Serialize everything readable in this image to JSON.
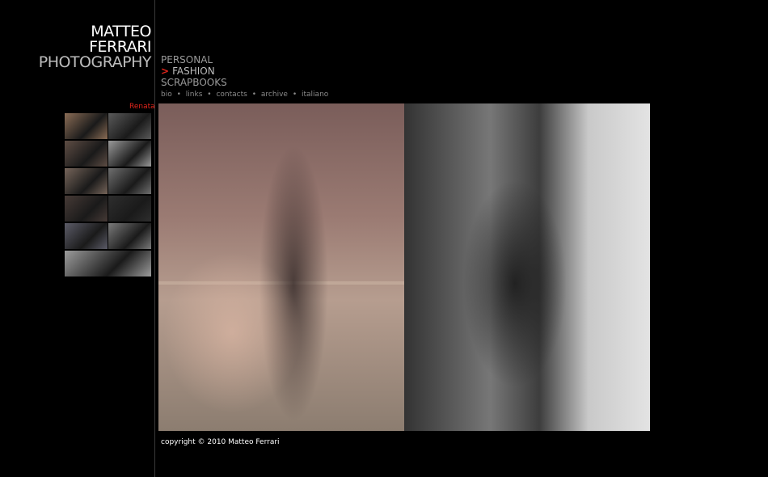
{
  "logo": {
    "line1": "MATTEO",
    "line2": "FERRARI",
    "line3": "PHOTOGRAPHY"
  },
  "menu": {
    "items": [
      {
        "label": "PERSONAL"
      },
      {
        "label": "FASHION",
        "marker": ">"
      },
      {
        "label": "SCRAPBOOKS"
      }
    ]
  },
  "sublinks": {
    "items": [
      "bio",
      "links",
      "contacts",
      "archive",
      "italiano"
    ],
    "separator": "•"
  },
  "album": {
    "title": "Renata"
  },
  "thumbnails": {
    "colors": [
      [
        "#8a6c55",
        "#5a5a5a"
      ],
      [
        "#5e4d44",
        "#9a9a9a"
      ],
      [
        "#76655a",
        "#6f6f6f"
      ],
      [
        "#463a36",
        "#2e2e2e"
      ],
      [
        "#5c5c68",
        "#7a7a7a"
      ],
      [
        "#9c9c9c"
      ]
    ]
  },
  "footer": {
    "copyright": "copyright © 2010 Matteo Ferrari"
  },
  "colors": {
    "accent": "#e0251b",
    "background": "#000000"
  }
}
